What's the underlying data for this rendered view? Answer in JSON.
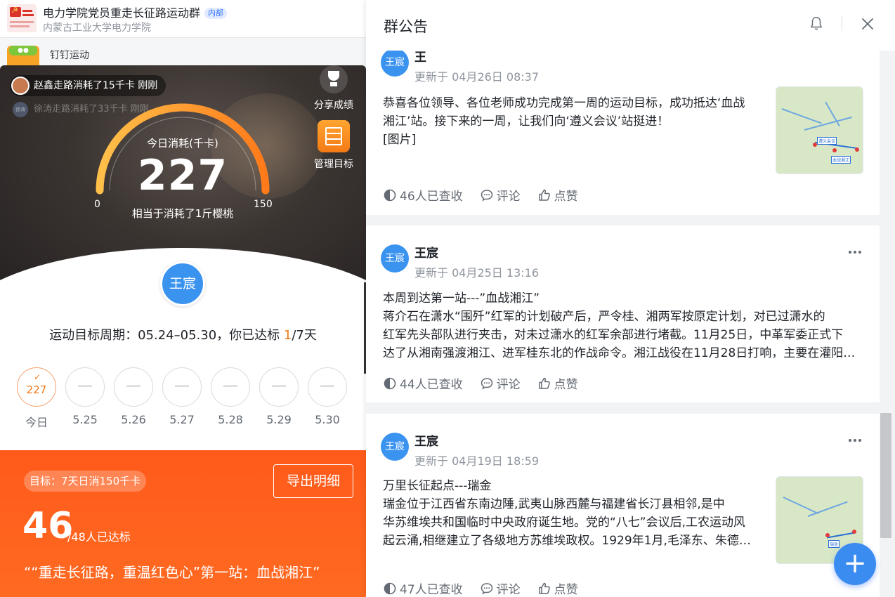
{
  "chat_list": {
    "group": {
      "title": "电力学院党员重走长征路运动群",
      "tag": "内部",
      "subtitle": "内蒙古工业大学电力学院"
    },
    "sport": {
      "name": "钉钉运动"
    }
  },
  "sport_card": {
    "ticker_1": "赵鑫走路消耗了15千卡 刚刚",
    "ticker_2": "徐涛走路消耗了33千卡 刚刚",
    "ticker_2_avatar_text": "徐涛",
    "gauge": {
      "title": "今日消耗(千卡)",
      "value": "227",
      "min": "0",
      "max": "150",
      "subtitle": "相当于消耗了1斤樱桃",
      "fill_fraction": 1.0
    },
    "share_label": "分享成绩",
    "manage_label": "管理目标",
    "user_badge": "王宸",
    "period_prefix": "运动目标周期：05.24–05.30，你已达标 ",
    "period_done": "1",
    "period_suffix": "/7天",
    "days": [
      {
        "value": "227",
        "label": "今日",
        "done": true
      },
      {
        "value": "—",
        "label": "5.25",
        "done": false
      },
      {
        "value": "—",
        "label": "5.26",
        "done": false
      },
      {
        "value": "—",
        "label": "5.27",
        "done": false
      },
      {
        "value": "—",
        "label": "5.28",
        "done": false
      },
      {
        "value": "—",
        "label": "5.29",
        "done": false
      },
      {
        "value": "—",
        "label": "5.30",
        "done": false
      }
    ],
    "goal_tag": "目标：7天日消150千卡",
    "export_button": "导出明细",
    "achieved_count": "46",
    "achieved_suffix": "/48人已达标",
    "campaign": "““重走长征路，重温红色心”第一站：血战湘江”",
    "colors": {
      "accent": "#ff5a1a",
      "gauge_start": "#ffc04a",
      "gauge_end": "#ff7a1a"
    }
  },
  "panel": {
    "title": "群公告",
    "icons": {
      "bell": "bell-icon",
      "close": "close-icon"
    },
    "announcements": [
      {
        "avatar": "王宸",
        "author": "王",
        "updated": "更新于 04月26日 08:37",
        "lines": [
          "恭喜各位领导、各位老师成功完成第一周的运动目标，成功抵达‘血战",
          "湘江’站。接下来的一周，让我们向‘遵义会议’站挺进！",
          "[图片]"
        ],
        "has_image": true,
        "read": "46人已查收",
        "comment": "评论",
        "like": "点赞"
      },
      {
        "avatar": "王宸",
        "author": "王宸",
        "updated": "更新于 04月25日 13:16",
        "lines": [
          "本周到达第一站---”血战湘江”",
          "        蒋介石在潇水“围歼”红军的计划破产后，严令桂、湘两军按原定计划，对已过潇水的",
          "红军先头部队进行夹击，对未过潇水的红军余部进行堵截。11月25日，中革军委正式下",
          "达了从湘南强渡湘江、进军桂东北的作战命令。湘江战役在11月28日打响，主要在灌阳…"
        ],
        "has_image": false,
        "read": "44人已查收",
        "comment": "评论",
        "like": "点赞"
      },
      {
        "avatar": "王宸",
        "author": "王宸",
        "updated": "更新于 04月19日 18:59",
        "lines": [
          "万里长征起点---瑞金",
          "      瑞金位于江西省东南边陲,武夷山脉西麓与福建省长汀县相邻,是中",
          "华苏维埃共和国临时中央政府诞生地。党的“八七”会议后,工农运动风",
          "起云涌,相继建立了各级地方苏维埃政权。1929年1月,毛泽东、朱德…"
        ],
        "has_image": true,
        "read": "47人已查收",
        "comment": "评论",
        "like": "点赞"
      }
    ],
    "map_labels": {
      "a": "遵义会议",
      "b": "血战湘江",
      "c": "瑞金"
    },
    "fab": "+"
  }
}
